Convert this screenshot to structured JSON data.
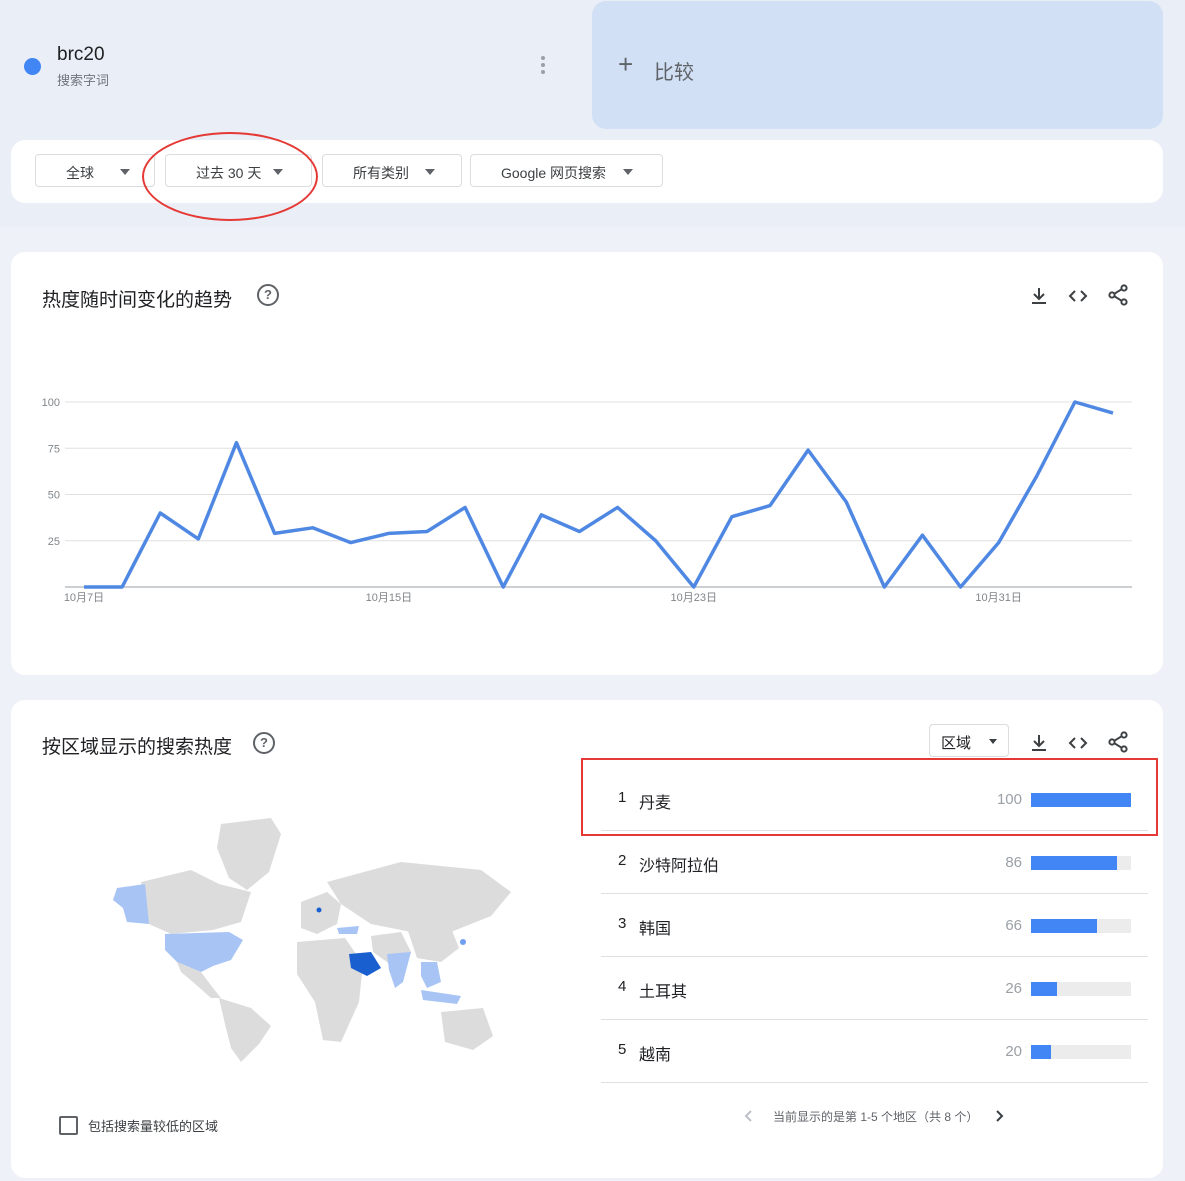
{
  "term": {
    "name": "brc20",
    "sub": "搜索字词",
    "color": "#4285f4"
  },
  "compare": {
    "label": "比较"
  },
  "filters": [
    {
      "label": "全球"
    },
    {
      "label": "过去 30 天"
    },
    {
      "label": "所有类别"
    },
    {
      "label": "Google 网页搜索"
    }
  ],
  "trend": {
    "title": "热度随时间变化的趋势",
    "help": "?"
  },
  "chart_data": {
    "type": "line",
    "x": [
      "10月7日",
      "10月8日",
      "10月9日",
      "10月10日",
      "10月11日",
      "10月12日",
      "10月13日",
      "10月14日",
      "10月15日",
      "10月16日",
      "10月17日",
      "10月18日",
      "10月19日",
      "10月20日",
      "10月21日",
      "10月22日",
      "10月23日",
      "10月24日",
      "10月25日",
      "10月26日",
      "10月27日",
      "10月28日",
      "10月29日",
      "10月30日",
      "10月31日",
      "11月1日",
      "11月2日",
      "11月3日"
    ],
    "series": [
      {
        "color": "#4f88e3",
        "values": [
          0,
          0,
          40,
          26,
          78,
          29,
          32,
          24,
          29,
          30,
          43,
          0,
          39,
          30,
          43,
          25,
          0,
          38,
          44,
          74,
          46,
          0,
          28,
          0,
          24,
          60,
          100,
          94
        ]
      }
    ],
    "xticks": [
      "10月7日",
      "10月15日",
      "10月23日",
      "10月31日"
    ],
    "yticks": [
      25,
      50,
      75,
      100
    ],
    "ylim": [
      0,
      100
    ],
    "grid": true,
    "title": "",
    "xlabel": "",
    "ylabel": ""
  },
  "region": {
    "title": "按区域显示的搜索热度",
    "help": "?",
    "select_label": "区域",
    "rows": [
      {
        "rank": "1",
        "name": "丹麦",
        "value": 100
      },
      {
        "rank": "2",
        "name": "沙特阿拉伯",
        "value": 86
      },
      {
        "rank": "3",
        "name": "韩国",
        "value": 66
      },
      {
        "rank": "4",
        "name": "土耳其",
        "value": 26
      },
      {
        "rank": "5",
        "name": "越南",
        "value": 20
      }
    ],
    "checkbox_label": "包括搜索量较低的区域",
    "pager_text": "当前显示的是第 1-5 个地区（共 8 个）"
  },
  "colors": {
    "accent": "#4285f4",
    "annotation_red": "#e53935",
    "map_light": "#a8c4f5",
    "map_dark": "#1a5fd0",
    "map_gray": "#dcdcdc"
  }
}
